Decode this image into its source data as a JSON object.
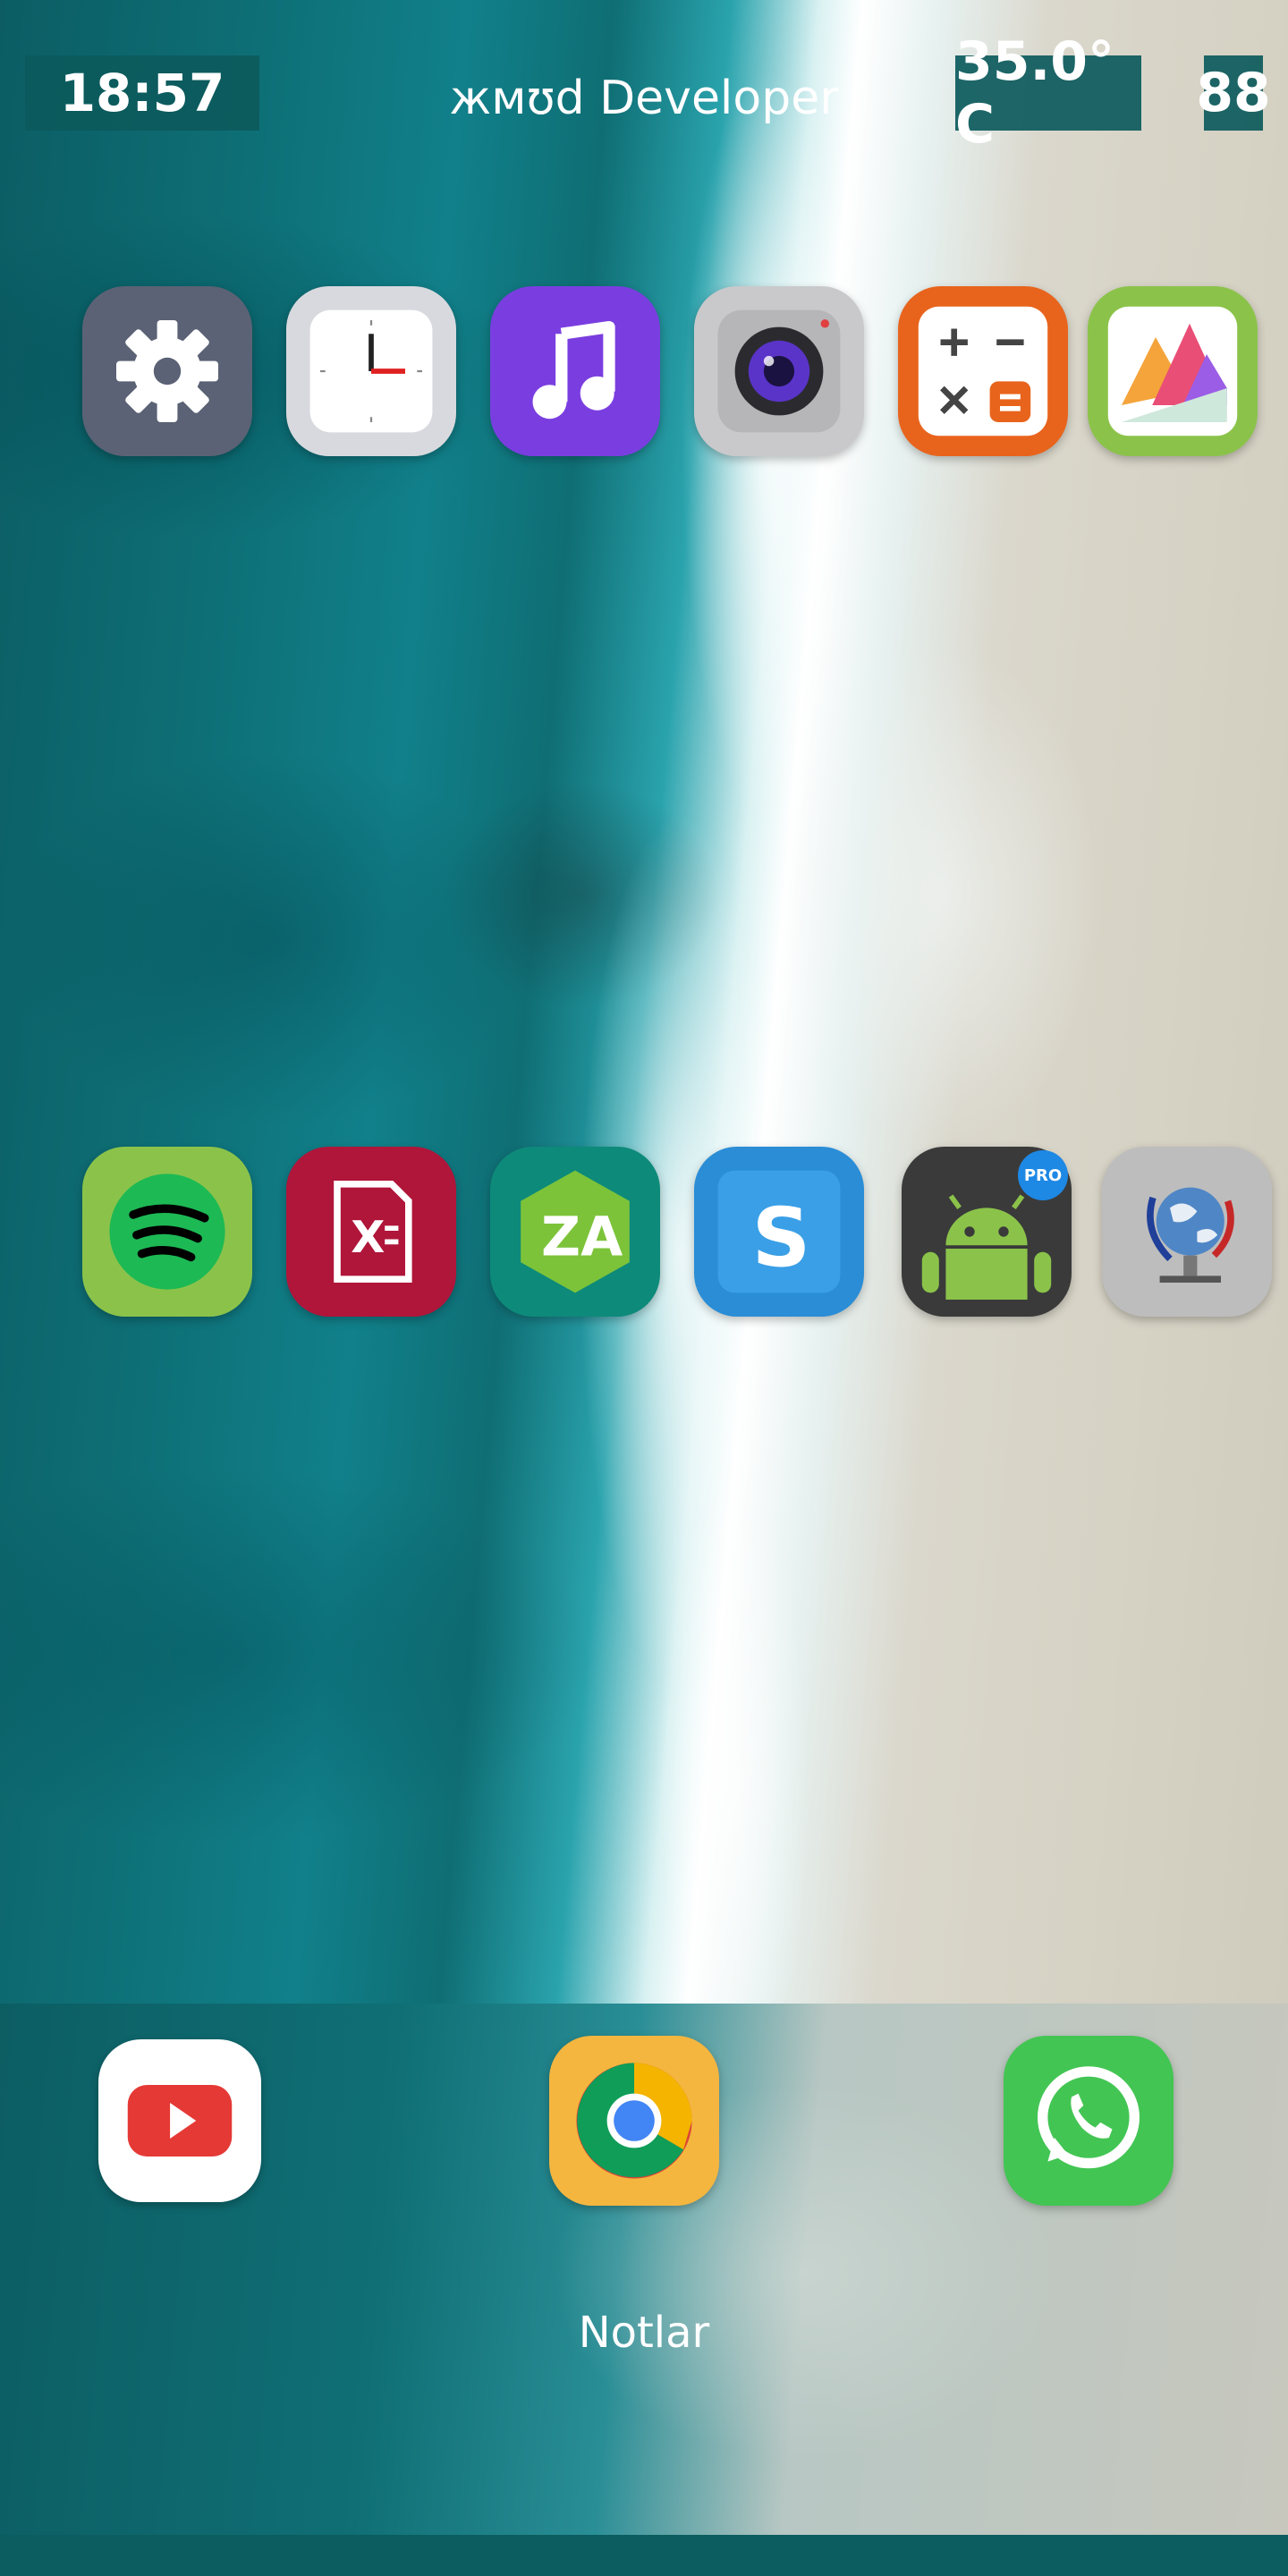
{
  "status_bar": {
    "time": "18:57",
    "carrier": "жмʊd Developer",
    "temperature": "35.0° C",
    "battery": "88"
  },
  "home_screen": {
    "row1": [
      {
        "icon": "settings-icon"
      },
      {
        "icon": "clock-icon"
      },
      {
        "icon": "music-icon"
      },
      {
        "icon": "camera-icon"
      },
      {
        "icon": "calculator-icon"
      },
      {
        "icon": "gallery-icon"
      }
    ],
    "row2": [
      {
        "icon": "spotify-icon"
      },
      {
        "icon": "excel-icon"
      },
      {
        "icon": "zarchiver-icon"
      },
      {
        "icon": "sketchware-icon"
      },
      {
        "icon": "android-pro-icon",
        "badge": "PRO"
      },
      {
        "icon": "network-globe-icon"
      }
    ]
  },
  "dock": {
    "apps": [
      {
        "icon": "youtube-icon"
      },
      {
        "icon": "chrome-icon"
      },
      {
        "icon": "whatsapp-icon"
      }
    ],
    "label": "Notlar"
  },
  "colors": {
    "status_bg": "#0c5a5c",
    "nav_strip": "#0b5d5f"
  }
}
